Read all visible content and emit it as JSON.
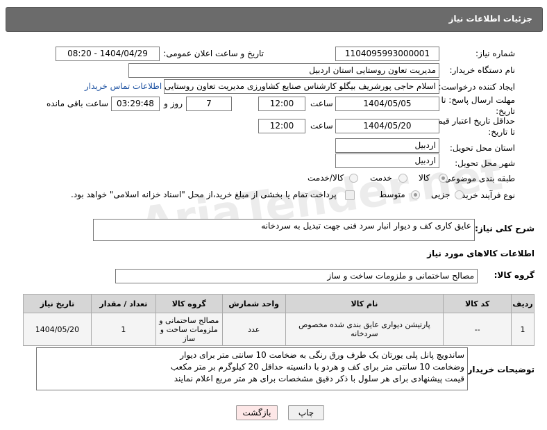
{
  "header": {
    "title": "جزئیات اطلاعات نیاز"
  },
  "fields": {
    "need_number_label": "شماره نیاز:",
    "need_number": "1104095993000001",
    "announce_label": "تاریخ و ساعت اعلان عمومی:",
    "announce_value": "1404/04/29 - 08:20",
    "buyer_org_label": "نام دستگاه خریدار:",
    "buyer_org": "مدیریت تعاون روستایی  استان اردبیل",
    "creator_label": "ایجاد کننده درخواست:",
    "creator": "اسلام حاجی پورشریف بیگلو کارشناس صنایع کشاورزی مدیریت تعاون روستایی",
    "contact_link": "اطلاعات تماس خریدار",
    "deadline_label": "مهلت ارسال پاسخ: تا تاریخ:",
    "deadline_date": "1404/05/05",
    "time_label": "ساعت",
    "deadline_time": "12:00",
    "days_value": "7",
    "days_label": "روز و",
    "remaining_time": "03:29:48",
    "remaining_label": "ساعت باقی مانده",
    "price_valid_label": "حداقل تاریخ اعتبار قیمت: تا تاریخ:",
    "price_valid_date": "1404/05/20",
    "price_valid_time": "12:00",
    "province_label": "استان محل تحویل:",
    "province": "اردبیل",
    "city_label": "شهر محل تحویل:",
    "city": "اردبیل",
    "category_label": "طبقه بندی موضوعی:",
    "category_opt1": "کالا",
    "category_opt2": "خدمت",
    "category_opt3": "کالا/خدمت",
    "process_label": "نوع فرآیند خرید :",
    "process_opt1": "جزیی",
    "process_opt2": "متوسط",
    "payment_note": "پرداخت تمام یا بخشی از مبلغ خرید،از محل \"اسناد خزانه اسلامی\" خواهد بود."
  },
  "description": {
    "label": "شرح کلی نیاز:",
    "value": "عایق کاری کف و دیوار انبار سرد فنی جهت تبدیل به سردخانه"
  },
  "goods_info": {
    "title": "اطلاعات کالاهای مورد نیاز",
    "group_label": "گروه کالا:",
    "group_value": "مصالح ساختمانی و ملزومات ساخت و ساز"
  },
  "table": {
    "headers": [
      "ردیف",
      "کد کالا",
      "نام کالا",
      "واحد شمارش",
      "گروه کالا",
      "تعداد / مقدار",
      "تاریخ نیاز"
    ],
    "rows": [
      [
        "1",
        "--",
        "پارتیشن دیواری عایق بندی شده مخصوص سردخانه",
        "عدد",
        "مصالح ساختمانی و ملزومات ساخت و ساز",
        "1",
        "1404/05/20"
      ]
    ]
  },
  "buyer_notes": {
    "label": "توضیحات خریدار:",
    "lines": [
      "ساندویچ پانل پلی یورتان یک طرف ورق رنگی به ضخامت 10 سانتی متر  برای دیوار",
      "وضخامت 10 سانتی متر برای کف و هردو با دانسیته حداقل 20 کیلوگرم بر متر مکعب",
      "قیمت پیشنهادی  برای هر سلول با ذکر دقیق مشخصات برای هر متر مربع  اعلام نمایند"
    ]
  },
  "buttons": {
    "print": "چاپ",
    "back": "بازگشت"
  },
  "watermark": "AriaTender.net"
}
